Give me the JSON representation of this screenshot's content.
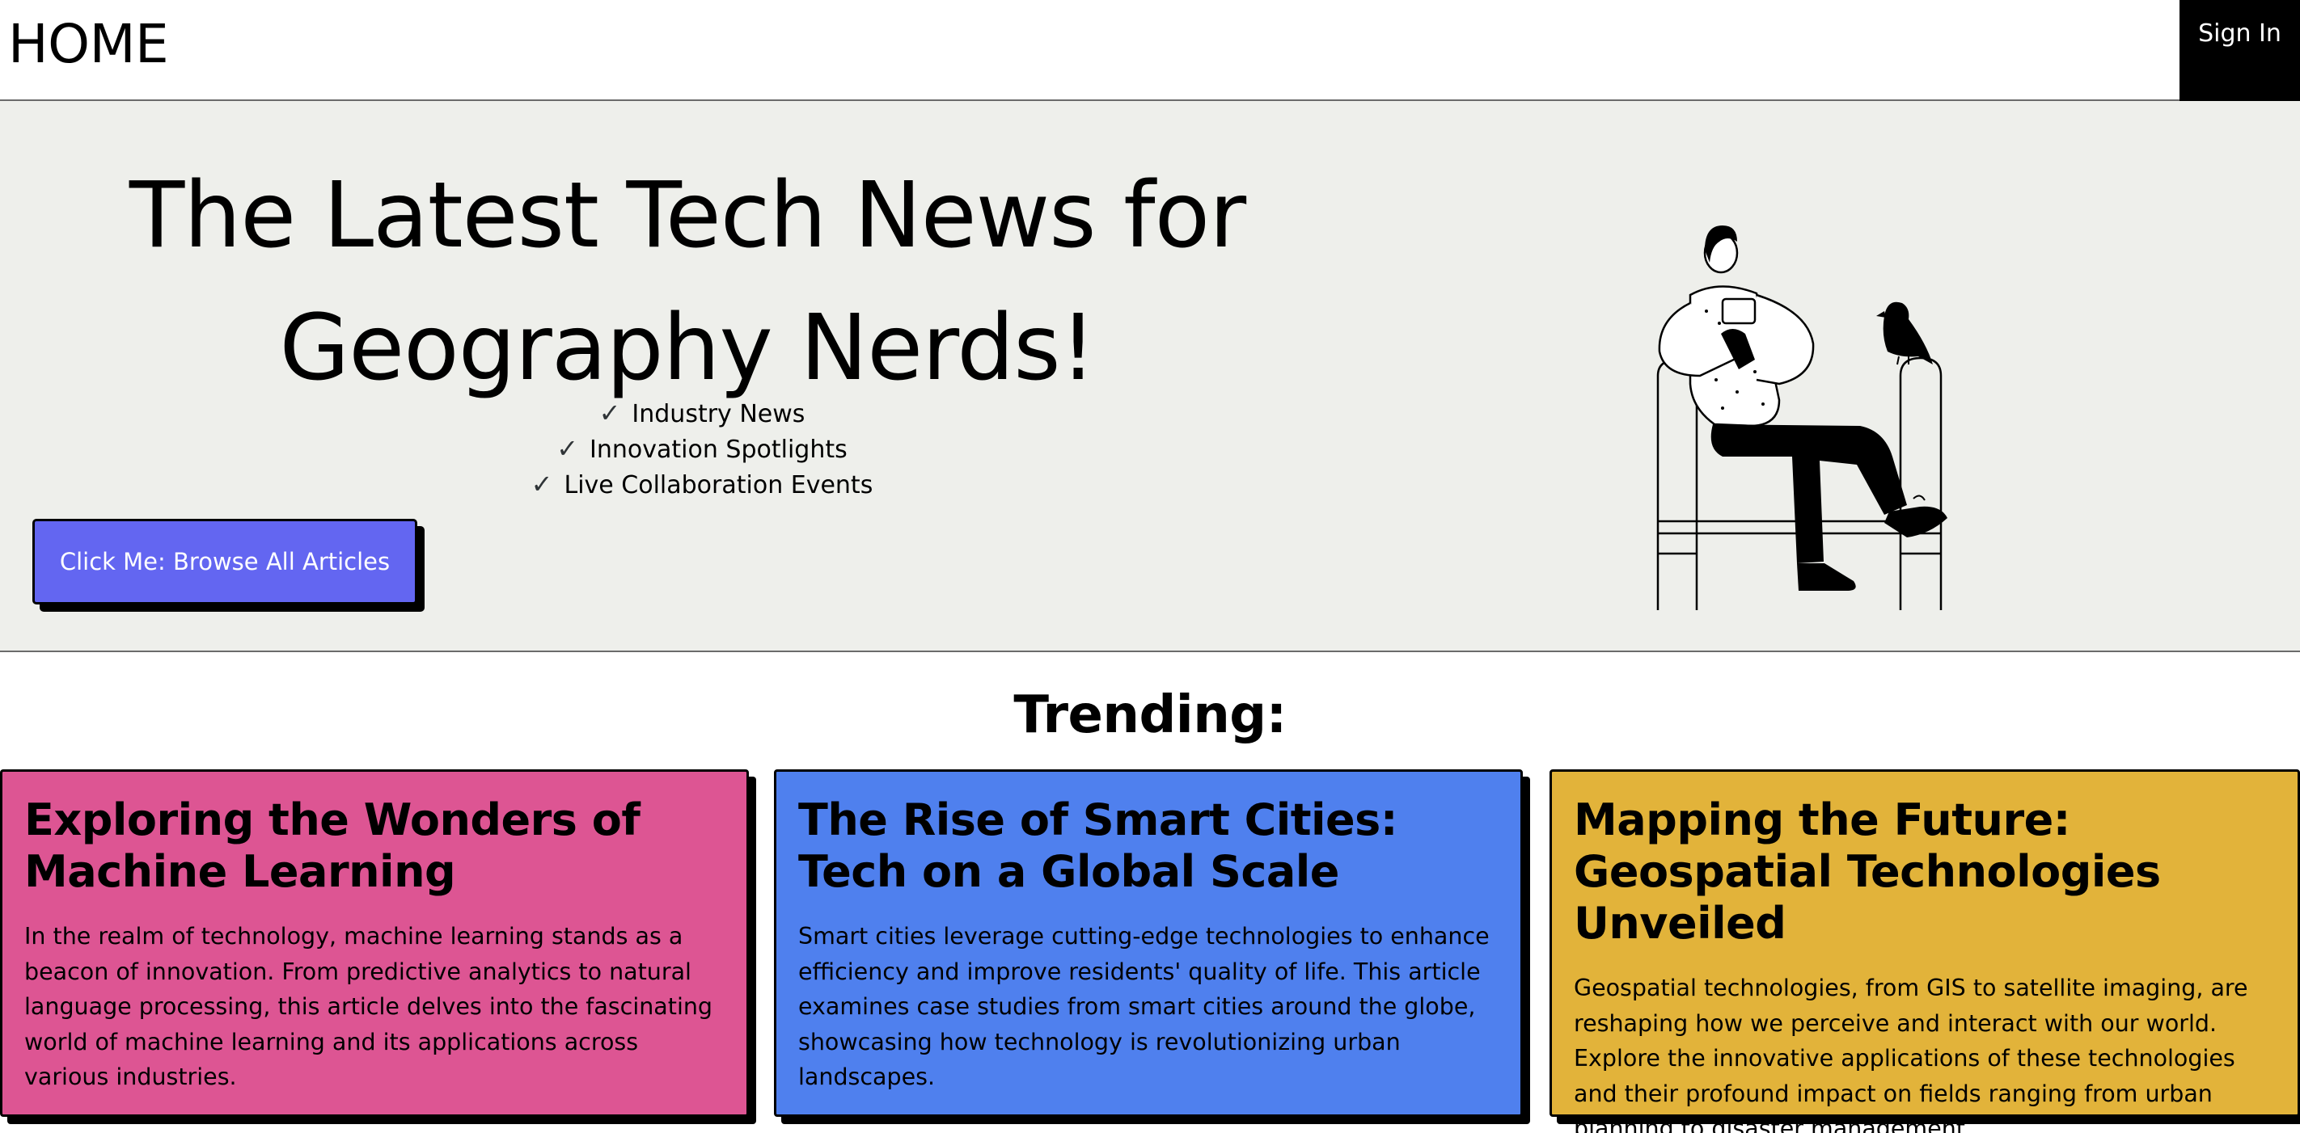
{
  "nav": {
    "home_label": "HOME",
    "signin_label": "Sign In"
  },
  "hero": {
    "title": "The Latest Tech News for Geography Nerds!",
    "features": [
      {
        "check_icon": "✓",
        "label": "Industry News"
      },
      {
        "check_icon": "✓",
        "label": "Innovation Spotlights"
      },
      {
        "check_icon": "✓",
        "label": "Live Collaboration Events"
      }
    ],
    "cta_label": "Click Me: Browse All Articles",
    "illustration_icon": "person-on-bench-with-bird-illustration"
  },
  "trending": {
    "title": "Trending:",
    "articles": [
      {
        "title": "Exploring the Wonders of Machine Learning",
        "text": "In the realm of technology, machine learning stands as a beacon of innovation. From predictive analytics to natural language processing, this article delves into the fascinating world of machine learning and its applications across various industries.",
        "color": "#dd5593"
      },
      {
        "title": "The Rise of Smart Cities: Tech on a Global Scale",
        "text": "Smart cities leverage cutting-edge technologies to enhance efficiency and improve residents' quality of life. This article examines case studies from smart cities around the globe, showcasing how technology is revolutionizing urban landscapes.",
        "color": "#4f80ee"
      },
      {
        "title": "Mapping the Future: Geospatial Technologies Unveiled",
        "text": "Geospatial technologies, from GIS to satellite imaging, are reshaping how we perceive and interact with our world. Explore the innovative applications of these technologies and their profound impact on fields ranging from urban planning to disaster management.",
        "color": "#e2b33a"
      }
    ]
  },
  "colors": {
    "accent": "#6366f1",
    "hero_bg": "#eeefeb",
    "border": "#000000"
  }
}
